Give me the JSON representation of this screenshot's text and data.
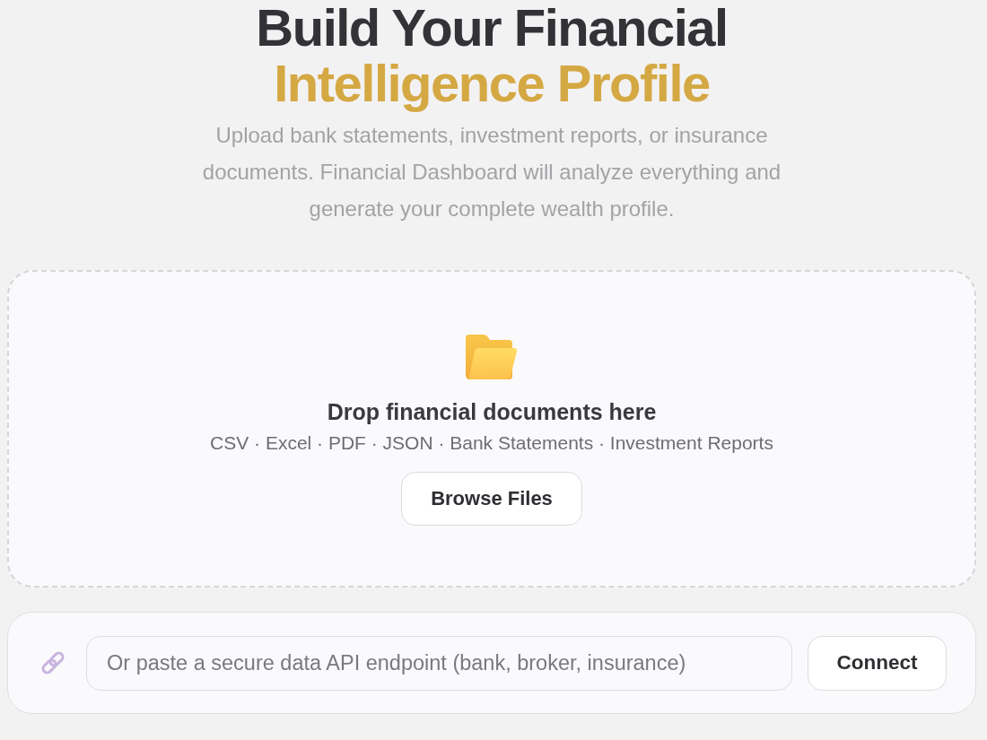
{
  "hero": {
    "title_line_1": "Build Your Financial",
    "title_line_2": "Intelligence Profile",
    "description": "Upload bank statements, investment reports, or insurance documents. Financial Dashboard will analyze everything and generate your complete wealth profile."
  },
  "dropzone": {
    "heading": "Drop financial documents here",
    "formats": "CSV · Excel · PDF · JSON · Bank Statements · Investment Reports",
    "button": "Browse Files"
  },
  "api_connect": {
    "placeholder": "Or paste a secure data API endpoint (bank, broker, insurance)",
    "button": "Connect"
  }
}
